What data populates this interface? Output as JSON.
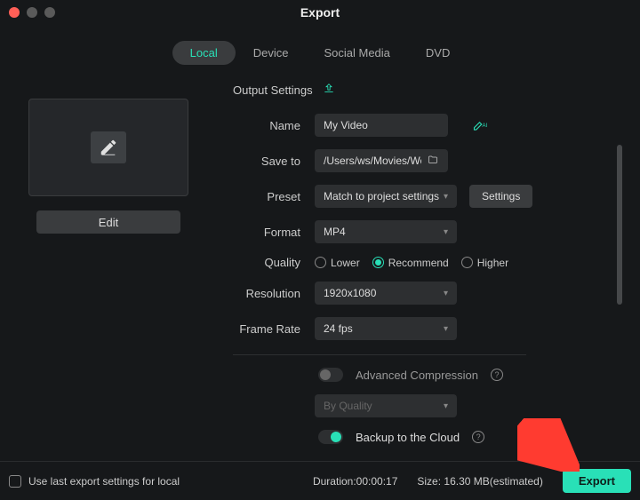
{
  "window": {
    "title": "Export"
  },
  "tabs": [
    {
      "label": "Local",
      "active": true
    },
    {
      "label": "Device",
      "active": false
    },
    {
      "label": "Social Media",
      "active": false
    },
    {
      "label": "DVD",
      "active": false
    }
  ],
  "left": {
    "edit_label": "Edit"
  },
  "section_header": "Output Settings",
  "form": {
    "name_label": "Name",
    "name_value": "My Video",
    "saveto_label": "Save to",
    "saveto_value": "/Users/ws/Movies/Wonder",
    "preset_label": "Preset",
    "preset_value": "Match to project settings",
    "settings_btn": "Settings",
    "format_label": "Format",
    "format_value": "MP4",
    "quality_label": "Quality",
    "quality_options": {
      "lower": "Lower",
      "recommend": "Recommend",
      "higher": "Higher"
    },
    "quality_selected": "recommend",
    "resolution_label": "Resolution",
    "resolution_value": "1920x1080",
    "framerate_label": "Frame Rate",
    "framerate_value": "24 fps",
    "adv_compression_label": "Advanced Compression",
    "adv_compression_on": false,
    "adv_mode_value": "By Quality",
    "backup_label": "Backup to the Cloud",
    "backup_on": true
  },
  "footer": {
    "use_last_label": "Use last export settings for local",
    "duration_label": "Duration:",
    "duration_value": "00:00:17",
    "size_label": "Size:",
    "size_value": "16.30 MB",
    "size_suffix": "(estimated)",
    "export_label": "Export"
  },
  "colors": {
    "accent": "#29e0b7",
    "bg": "#16181a"
  }
}
